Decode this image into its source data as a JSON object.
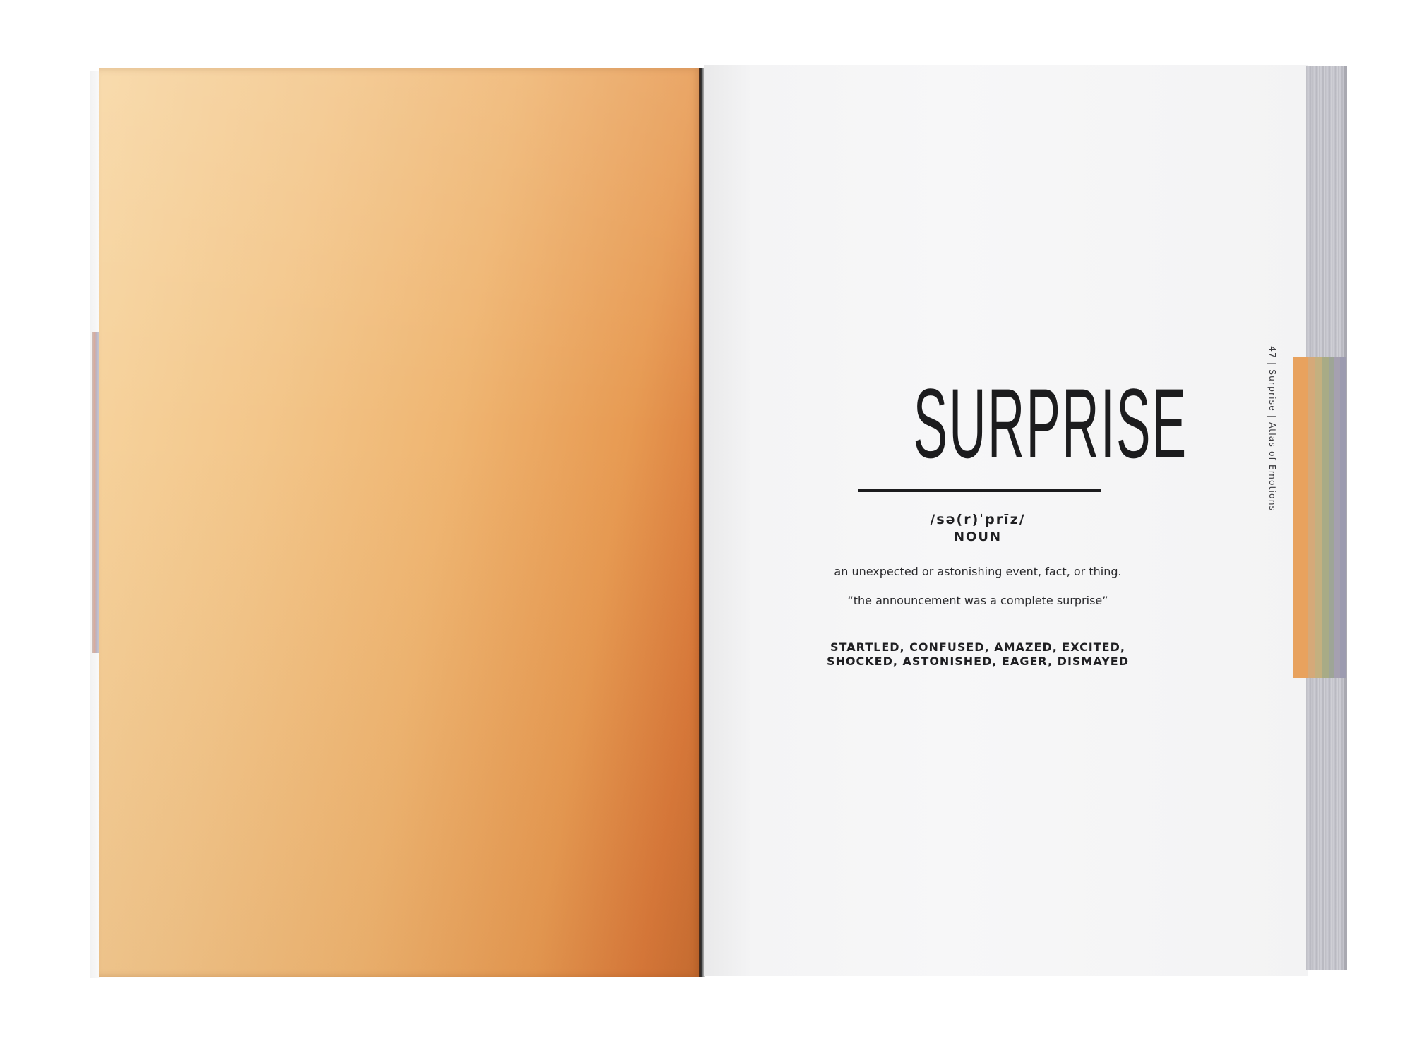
{
  "book": {
    "left_page_color": "#efb571",
    "right_page": {
      "title": "SURPRISE",
      "pronunciation": "/sə(r)ˈprīz/",
      "part_of_speech": "NOUN",
      "definition": "an unexpected or astonishing event, fact, or thing.",
      "example": "“the announcement was a complete surprise”",
      "synonyms_line1": "STARTLED, CONFUSED, AMAZED, EXCITED,",
      "synonyms_line2": "SHOCKED, ASTONISHED, EAGER, DISMAYED",
      "running_footer": "47 | Surprise | Atlas of Emotions"
    },
    "edge_tab_colors": [
      "#e8a25e",
      "#d5a979",
      "#c4b07f",
      "#a8ab86",
      "#9ea597",
      "#a5a0b0",
      "#9c9bb0"
    ]
  }
}
